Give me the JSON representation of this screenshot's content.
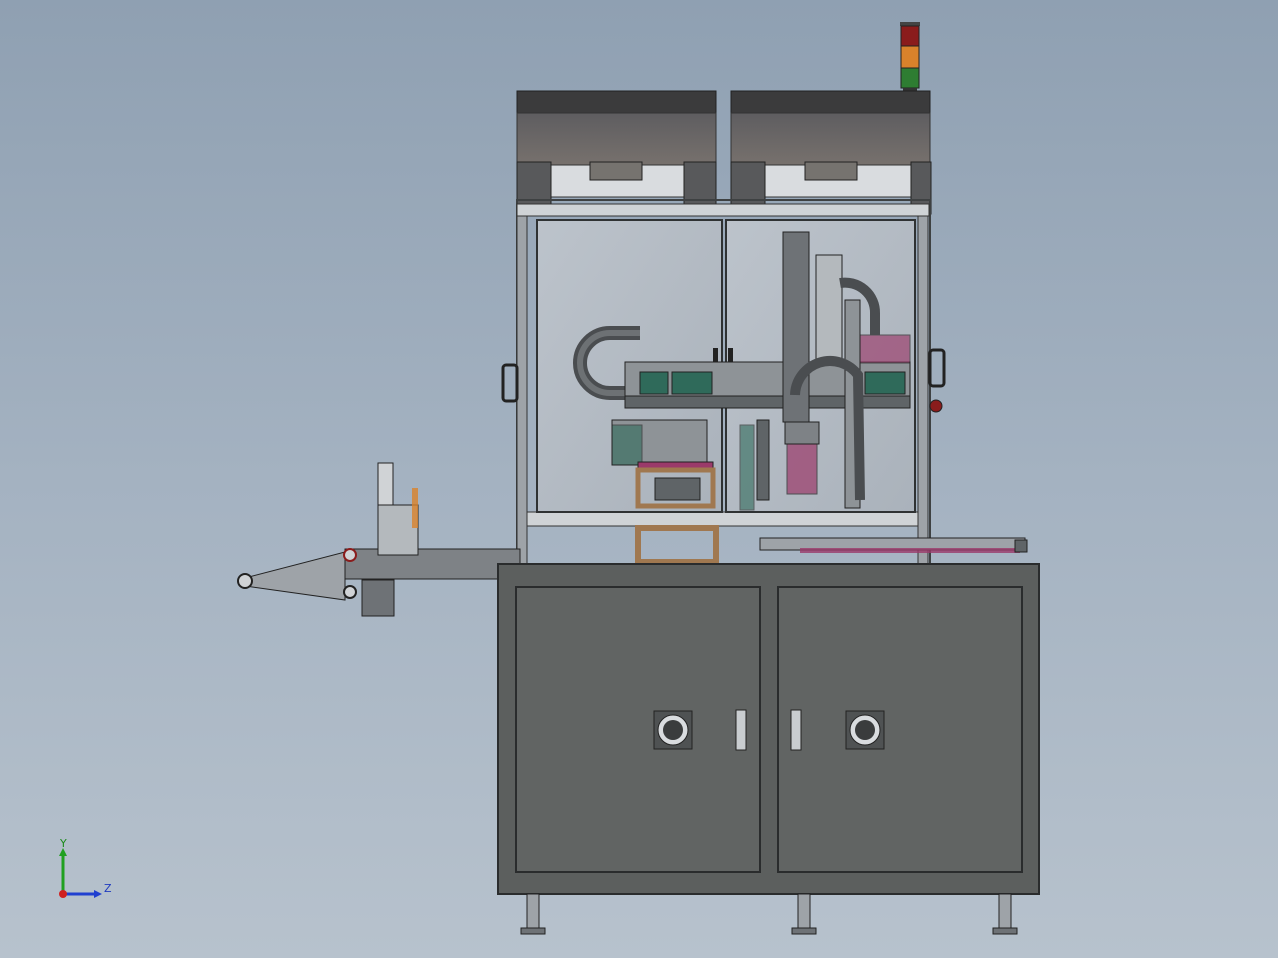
{
  "colors": {
    "background_top": "#8fa0b2",
    "background_bottom": "#b7c2cd",
    "cabinet": "#5c5f5e",
    "cabinet_panel": "#616463",
    "frame": "#3e4142",
    "glass": "#b4bbc3",
    "hood": "#6b6b6d",
    "signal_red": "#8a1c1c",
    "signal_orange": "#d9822b",
    "signal_green": "#2e7d32",
    "accent_magenta": "#9b3a6a",
    "accent_teal": "#2f6a5a",
    "wood_frame": "#a07850",
    "axis_x": "#d02020",
    "axis_y": "#20a020",
    "axis_z": "#2040d0"
  },
  "triad": {
    "y_label": "Y",
    "z_label": "Z",
    "x_icon": "x-axis-arrow-icon",
    "y_icon": "y-axis-arrow-icon",
    "z_icon": "z-axis-arrow-icon"
  },
  "icons": {
    "signal_tower": "signal-tower-icon",
    "fan": "fan-grille-icon",
    "handle": "door-handle-icon",
    "foot": "leveling-foot-icon"
  }
}
